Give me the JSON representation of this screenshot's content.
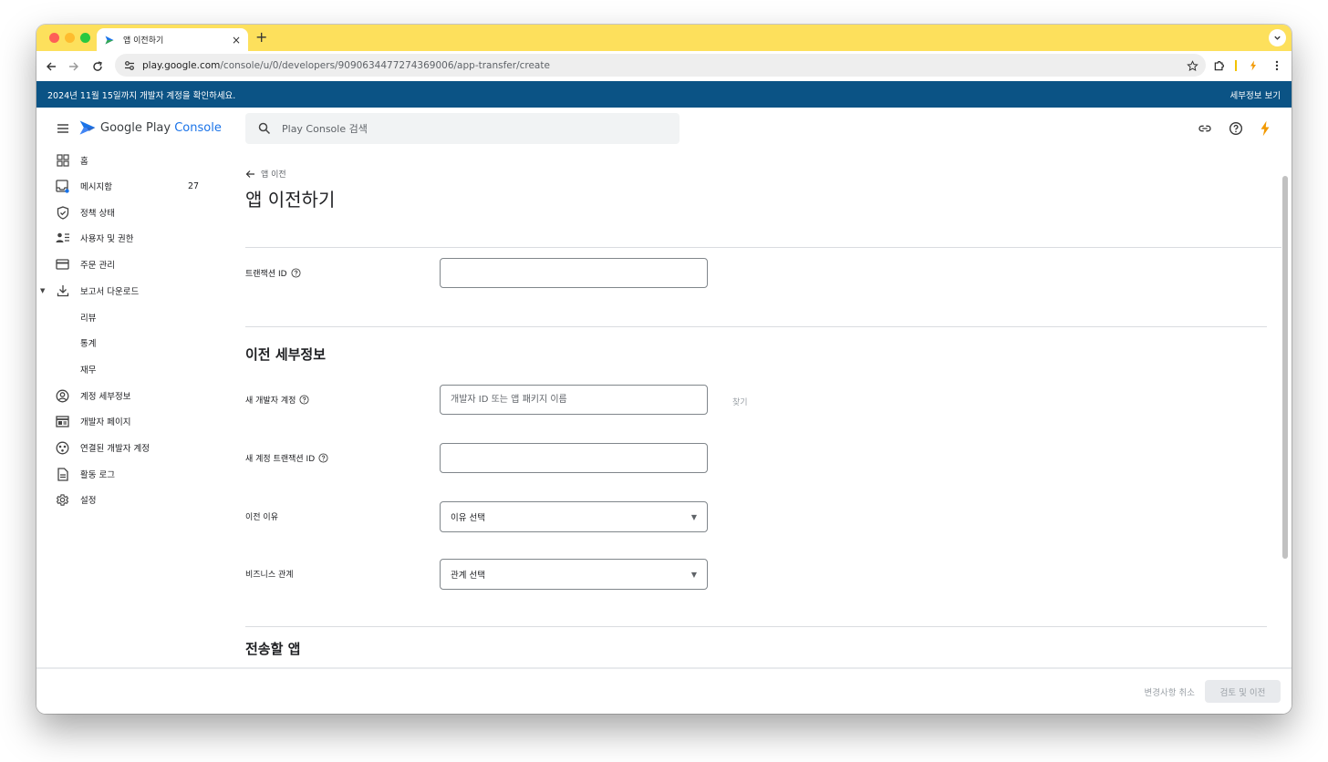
{
  "browser": {
    "tab_title": "앱 이전하기",
    "tab_close": "×",
    "new_tab": "+",
    "tab_menu": "⌄",
    "url_host": "play.google.com",
    "url_path": "/console/u/0/developers/9090634477274369006/app-transfer/create"
  },
  "banner": {
    "text": "2024년 11월 15일까지 개발자 계정을 확인하세요.",
    "link": "세부정보 보기"
  },
  "header": {
    "logo_google_play": "Google Play",
    "logo_console": "Console",
    "search_placeholder": "Play Console 검색"
  },
  "sidebar": {
    "items": [
      {
        "label": "홈",
        "icon": "dashboard-icon"
      },
      {
        "label": "메시지함",
        "icon": "inbox-icon",
        "count": "27"
      },
      {
        "label": "정책 상태",
        "icon": "shield-icon"
      },
      {
        "label": "사용자 및 권한",
        "icon": "users-icon"
      },
      {
        "label": "주문 관리",
        "icon": "credit-card-icon"
      },
      {
        "label": "보고서 다운로드",
        "icon": "download-icon"
      },
      {
        "label": "리뷰"
      },
      {
        "label": "통계"
      },
      {
        "label": "재무"
      },
      {
        "label": "계정 세부정보",
        "icon": "account-icon"
      },
      {
        "label": "개발자 페이지",
        "icon": "web-icon"
      },
      {
        "label": "연결된 개발자 계정",
        "icon": "linked-accounts-icon"
      },
      {
        "label": "활동 로그",
        "icon": "document-icon"
      },
      {
        "label": "설정",
        "icon": "gear-icon"
      }
    ]
  },
  "main": {
    "back_label": "앱 이전",
    "title": "앱 이전하기",
    "transaction_id_label": "트랜잭션 ID",
    "transfer_details_title": "이전 세부정보",
    "new_developer_label": "새 개발자 계정",
    "new_developer_placeholder": "개발자 ID 또는 앱 패키지 이름",
    "find_label": "찾기",
    "new_transaction_id_label": "새 계정 트랜잭션 ID",
    "reason_label": "이전 이유",
    "reason_value": "이유 선택",
    "business_label": "비즈니스 관계",
    "business_value": "관계 선택",
    "apps_title": "전송할 앱"
  },
  "footer": {
    "cancel_label": "변경사항 취소",
    "review_label": "검토 및 이전"
  },
  "colors": {
    "titlebar": "#fde05c",
    "banner": "#0b5385",
    "accent": "#1a73e8"
  }
}
